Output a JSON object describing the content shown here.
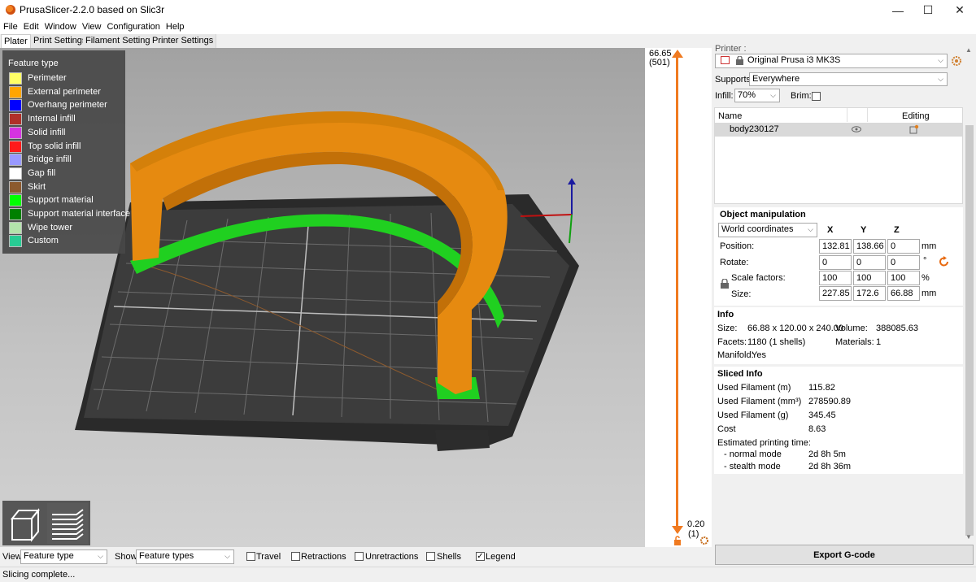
{
  "window": {
    "title": "PrusaSlicer-2.2.0 based on Slic3r",
    "minimize": "—",
    "maximize": "☐",
    "close": "✕"
  },
  "menu": [
    "File",
    "Edit",
    "Window",
    "View",
    "Configuration",
    "Help"
  ],
  "tabs": [
    "Plater",
    "Print Settings",
    "Filament Settings",
    "Printer Settings"
  ],
  "legend": {
    "title": "Feature type",
    "items": [
      {
        "label": "Perimeter",
        "color": "#ffff66"
      },
      {
        "label": "External perimeter",
        "color": "#ffa500"
      },
      {
        "label": "Overhang perimeter",
        "color": "#0000ff"
      },
      {
        "label": "Internal infill",
        "color": "#b03029"
      },
      {
        "label": "Solid infill",
        "color": "#d633e0"
      },
      {
        "label": "Top solid infill",
        "color": "#ff1a1a"
      },
      {
        "label": "Bridge infill",
        "color": "#9999ff"
      },
      {
        "label": "Gap fill",
        "color": "#ffffff"
      },
      {
        "label": "Skirt",
        "color": "#8c5a2e"
      },
      {
        "label": "Support material",
        "color": "#00ff00"
      },
      {
        "label": "Support material interface",
        "color": "#008000"
      },
      {
        "label": "Wipe tower",
        "color": "#b3e3ab"
      },
      {
        "label": "Custom",
        "color": "#28cc94"
      }
    ]
  },
  "layer_slider": {
    "top_value": "66.65",
    "top_layer": "(501)",
    "bottom_value": "0.20",
    "bottom_layer": "(1)"
  },
  "printer": {
    "label": "Printer :",
    "value": "Original Prusa i3 MK3S"
  },
  "supports": {
    "label": "Supports:",
    "value": "Everywhere"
  },
  "infill": {
    "label": "Infill:",
    "value": "70%"
  },
  "brim": {
    "label": "Brim:",
    "checked": false
  },
  "object_list": {
    "col_name": "Name",
    "col_editing": "Editing",
    "items": [
      {
        "name": "body230127"
      }
    ]
  },
  "object_manipulation": {
    "title": "Object manipulation",
    "coord_system": "World coordinates",
    "axis_x": "X",
    "axis_y": "Y",
    "axis_z": "Z",
    "position": {
      "label": "Position:",
      "x": "132.81",
      "y": "138.66",
      "z": "0",
      "unit": "mm"
    },
    "rotate": {
      "label": "Rotate:",
      "x": "0",
      "y": "0",
      "z": "0",
      "unit": "°"
    },
    "scale": {
      "label": "Scale factors:",
      "x": "100",
      "y": "100",
      "z": "100",
      "unit": "%"
    },
    "size": {
      "label": "Size:",
      "x": "227.85",
      "y": "172.6",
      "z": "66.88",
      "unit": "mm"
    }
  },
  "info": {
    "title": "Info",
    "size_label": "Size:",
    "size_value": "66.88 x 120.00 x 240.00",
    "volume_label": "Volume:",
    "volume_value": "388085.63",
    "facets_label": "Facets:",
    "facets_value": "1180 (1 shells)",
    "materials_label": "Materials:",
    "materials_value": "1",
    "manifold_label": "Manifold:",
    "manifold_value": "Yes"
  },
  "sliced_info": {
    "title": "Sliced Info",
    "rows": [
      {
        "label": "Used Filament (m)",
        "value": "115.82"
      },
      {
        "label": "Used Filament (mm³)",
        "value": "278590.89"
      },
      {
        "label": "Used Filament (g)",
        "value": "345.45"
      },
      {
        "label": "Cost",
        "value": "8.63"
      }
    ],
    "est_label": "Estimated printing time:",
    "normal_label": "- normal mode",
    "normal_value": "2d 8h 5m",
    "stealth_label": "- stealth mode",
    "stealth_value": "2d 8h 36m"
  },
  "export_button": "Export G-code",
  "bottom_bar": {
    "view_label": "View",
    "view_value": "Feature type",
    "show_label": "Show",
    "show_value": "Feature types",
    "travel": {
      "label": "Travel",
      "checked": false
    },
    "retractions": {
      "label": "Retractions",
      "checked": false
    },
    "unretractions": {
      "label": "Unretractions",
      "checked": false
    },
    "shells": {
      "label": "Shells",
      "checked": false
    },
    "legend": {
      "label": "Legend",
      "checked": true
    }
  },
  "status": "Slicing complete..."
}
